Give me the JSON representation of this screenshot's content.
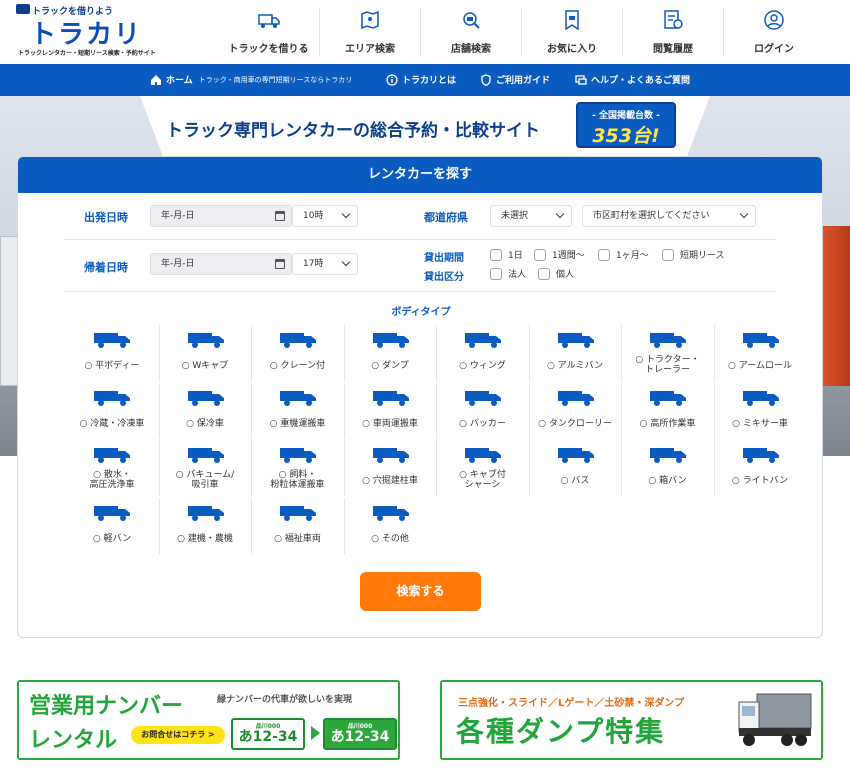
{
  "header": {
    "tagline": "トラックを借りよう",
    "brand": "トラカリ",
    "brand_sub": "トラックレンタカー・短期リース検索・予約サイト",
    "nav": [
      {
        "label": "トラックを借りる",
        "icon": "truck-icon"
      },
      {
        "label": "エリア検索",
        "icon": "map-icon"
      },
      {
        "label": "店舗検索",
        "icon": "store-search-icon"
      },
      {
        "label": "お気に入り",
        "icon": "bookmark-icon"
      },
      {
        "label": "閲覧履歴",
        "icon": "history-icon"
      },
      {
        "label": "ログイン",
        "icon": "user-icon"
      }
    ]
  },
  "bluebar": {
    "home": "ホーム",
    "home_note": "トラック・商用車の専門短期リースならトラカリ",
    "about": "トラカリとは",
    "guide": "ご利用ガイド",
    "help": "ヘルプ・よくあるご質問"
  },
  "hero": {
    "title": "トラック専門レンタカーの総合予約・比較サイト",
    "count_label": "- 全国掲載台数 -",
    "count_value": "353台!"
  },
  "search": {
    "title": "レンタカーを探す",
    "depart_label": "出発日時",
    "return_label": "帰着日時",
    "date_placeholder": "年-月-日",
    "depart_time": "10時",
    "return_time": "17時",
    "pref_label": "都道府県",
    "pref_value": "未選択",
    "city_value": "市区町村を選択してください",
    "period_label": "貸出期間",
    "period_options": [
      "1日",
      "1週間〜",
      "1ヶ月〜",
      "短期リース"
    ],
    "class_label": "貸出区分",
    "class_options": [
      "法人",
      "個人"
    ],
    "body_type_title": "ボディタイプ",
    "body_types": [
      {
        "line1": "○ 平ボディー",
        "line2": ""
      },
      {
        "line1": "○ Wキャブ",
        "line2": ""
      },
      {
        "line1": "○ クレーン付",
        "line2": ""
      },
      {
        "line1": "○ ダンプ",
        "line2": ""
      },
      {
        "line1": "○ ウィング",
        "line2": ""
      },
      {
        "line1": "○ アルミバン",
        "line2": ""
      },
      {
        "line1": "○ トラクター・",
        "line2": "トレーラー"
      },
      {
        "line1": "○ アームロール",
        "line2": ""
      },
      {
        "line1": "○ 冷蔵・冷凍車",
        "line2": ""
      },
      {
        "line1": "○ 保冷車",
        "line2": ""
      },
      {
        "line1": "○ 重機運搬車",
        "line2": ""
      },
      {
        "line1": "○ 車両運搬車",
        "line2": ""
      },
      {
        "line1": "○ パッカー",
        "line2": ""
      },
      {
        "line1": "○ タンクローリー",
        "line2": ""
      },
      {
        "line1": "○ 高所作業車",
        "line2": ""
      },
      {
        "line1": "○ ミキサー車",
        "line2": ""
      },
      {
        "line1": "○ 散水・",
        "line2": "高圧洗浄車"
      },
      {
        "line1": "○ バキューム/",
        "line2": "吸引車"
      },
      {
        "line1": "○ 飼料・",
        "line2": "粉粒体運搬車"
      },
      {
        "line1": "○ 穴掘建柱車",
        "line2": ""
      },
      {
        "line1": "○ キャブ付",
        "line2": "シャーシ"
      },
      {
        "line1": "○ バス",
        "line2": ""
      },
      {
        "line1": "○ 箱バン",
        "line2": ""
      },
      {
        "line1": "○ ライトバン",
        "line2": ""
      },
      {
        "line1": "○ 軽バン",
        "line2": ""
      },
      {
        "line1": "○ 建機・農機",
        "line2": ""
      },
      {
        "line1": "○ 福祉車両",
        "line2": ""
      },
      {
        "line1": "○ その他",
        "line2": ""
      }
    ],
    "submit": "検索する"
  },
  "promo": {
    "left_title1": "営業用ナンバー",
    "left_title2": "レンタル",
    "left_sub": "緑ナンバーの代車が欲しいを実現",
    "left_button": "お問合せはコチラ >",
    "plate_top": "品川000",
    "plate_num_white": "あ12-34",
    "plate_num_green": "あ12-34",
    "right_sub": "三点強化・スライド／Lゲート／土砂禁・深ダンプ",
    "right_title": "各種ダンプ特集"
  },
  "colors": {
    "primary": "#0b5cc0",
    "accent": "#ff7a0a",
    "promo_green": "#2ea83e"
  }
}
